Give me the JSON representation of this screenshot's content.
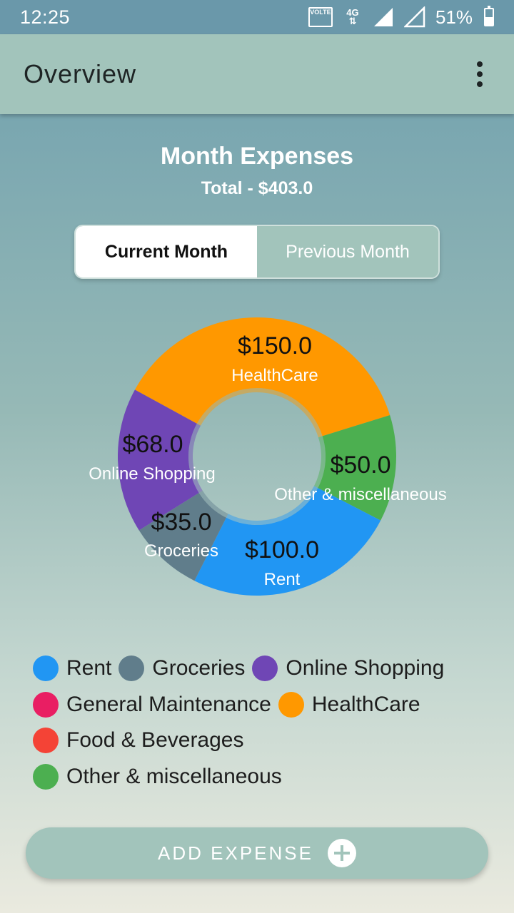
{
  "status_bar": {
    "time": "12:25",
    "volte": "VOLTE",
    "network": "4G",
    "battery": "51%",
    "battery_level": 0.51
  },
  "app_bar": {
    "title": "Overview",
    "menu_icon": "more-vert-icon"
  },
  "summary": {
    "title": "Month Expenses",
    "total": "Total - $403.0"
  },
  "tabs": [
    {
      "label": "Current Month",
      "selected": true
    },
    {
      "label": "Previous Month",
      "selected": false
    }
  ],
  "chart_data": {
    "type": "pie",
    "donut": true,
    "slices": [
      {
        "label": "HealthCare",
        "value_label": "$150.0",
        "value": 150.0,
        "color": "#FF9800"
      },
      {
        "label": "Other & miscellaneous",
        "value_label": "$50.0",
        "value": 50.0,
        "color": "#4CAF50"
      },
      {
        "label": "Rent",
        "value_label": "$100.0",
        "value": 100.0,
        "color": "#2196F3"
      },
      {
        "label": "Groceries",
        "value_label": "$35.0",
        "value": 35.0,
        "color": "#607D8B"
      },
      {
        "label": "Online Shopping",
        "value_label": "$68.0",
        "value": 68.0,
        "color": "#6F46B5"
      }
    ]
  },
  "legend": {
    "rows": [
      [
        {
          "label": "Rent",
          "color": "#2196F3"
        },
        {
          "label": "Groceries",
          "color": "#607D8B"
        },
        {
          "label": "Online Shopping",
          "color": "#6F46B5"
        }
      ],
      [
        {
          "label": "General Maintenance",
          "color": "#E91E63"
        },
        {
          "label": "HealthCare",
          "color": "#FF9800"
        }
      ],
      [
        {
          "label": "Food & Beverages",
          "color": "#F44336"
        }
      ],
      [
        {
          "label": "Other & miscellaneous",
          "color": "#4CAF50"
        }
      ]
    ]
  },
  "add_button": {
    "label": "ADD EXPENSE",
    "icon": "add-circle-icon"
  }
}
